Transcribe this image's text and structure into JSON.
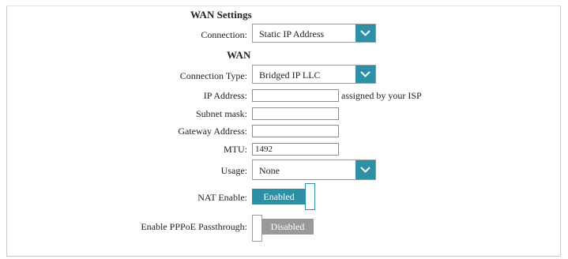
{
  "section": {
    "title": "WAN Settings"
  },
  "connection": {
    "label": "Connection:",
    "value": "Static IP Address"
  },
  "wan": {
    "title": "WAN",
    "connection_type": {
      "label": "Connection Type:",
      "value": "Bridged IP LLC"
    },
    "ip_address": {
      "label": "IP Address:",
      "value": "",
      "hint": "assigned by your ISP"
    },
    "subnet_mask": {
      "label": "Subnet mask:",
      "value": ""
    },
    "gateway": {
      "label": "Gateway Address:",
      "value": ""
    },
    "mtu": {
      "label": "MTU:",
      "value": "1492"
    },
    "usage": {
      "label": "Usage:",
      "value": "None"
    },
    "nat": {
      "label": "NAT Enable:",
      "state": "Enabled"
    },
    "pppoe": {
      "label": "Enable PPPoE Passthrough:",
      "state": "Disabled"
    }
  },
  "colors": {
    "accent": "#2f8fa5",
    "disabled": "#999999"
  },
  "icons": {
    "dropdown": "chevron-down-icon"
  }
}
